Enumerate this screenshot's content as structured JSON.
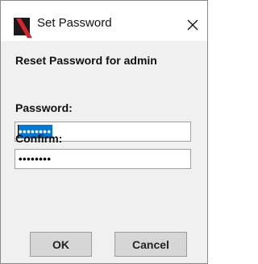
{
  "window": {
    "title": "Set Password",
    "app_icon": "app-logo-icon",
    "close_icon": "close-icon"
  },
  "form": {
    "heading": "Reset Password for admin",
    "password_label": "Password:",
    "password_value": "••••••••",
    "confirm_label": "Confirm:",
    "confirm_value": "••••••••"
  },
  "buttons": {
    "ok_label": "OK",
    "cancel_label": "Cancel"
  },
  "colors": {
    "selection": "#0078d7",
    "dialog_background": "#f0f0f0",
    "button_background": "#d6d6d6"
  }
}
